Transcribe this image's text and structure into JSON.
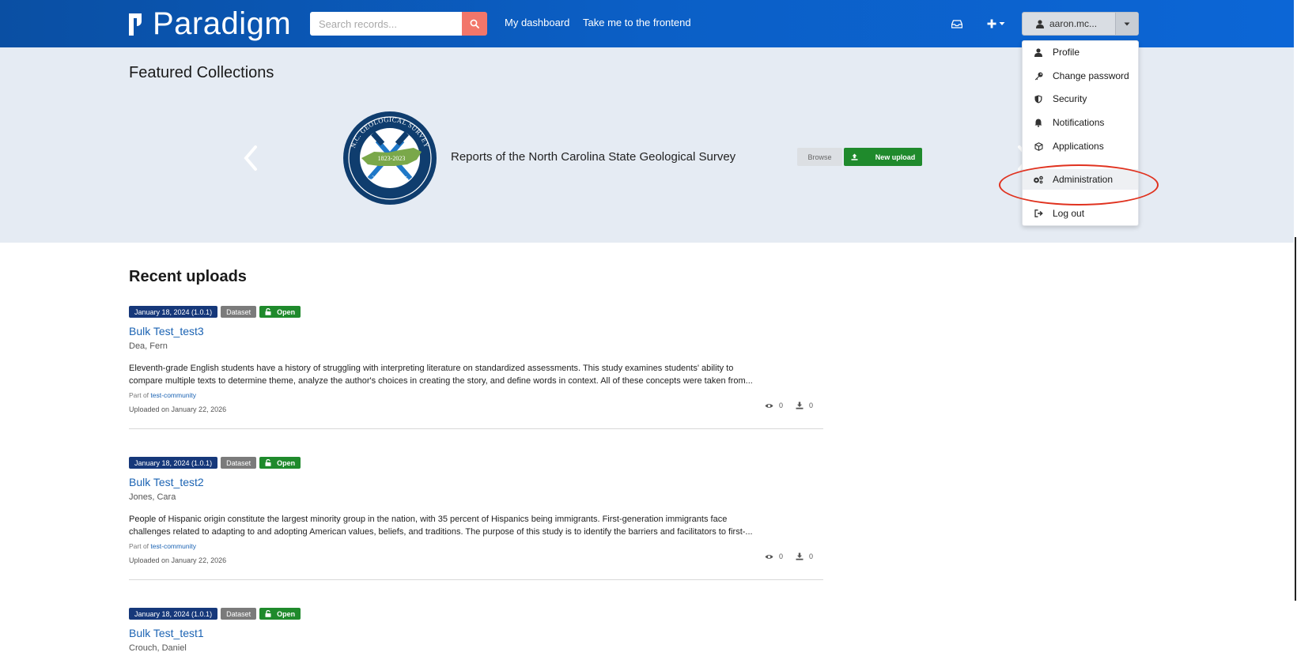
{
  "header": {
    "brand": "Paradigm",
    "search": {
      "placeholder": "Search records..."
    },
    "nav": {
      "dashboard": "My dashboard",
      "frontend": "Take me to the frontend"
    },
    "user": {
      "name": "aaron.mc..."
    }
  },
  "user_menu": {
    "items": [
      {
        "label": "Profile",
        "icon": "user-icon"
      },
      {
        "label": "Change password",
        "icon": "key-icon"
      },
      {
        "label": "Security",
        "icon": "shield-icon"
      },
      {
        "label": "Notifications",
        "icon": "bell-icon"
      },
      {
        "label": "Applications",
        "icon": "cube-icon"
      },
      {
        "label": "Administration",
        "icon": "cogs-icon"
      },
      {
        "label": "Log out",
        "icon": "logout-icon"
      }
    ],
    "highlighted": "Administration"
  },
  "featured": {
    "title": "Featured Collections",
    "collection": {
      "title": "Reports of the North Carolina State Geological Survey",
      "logo_text_top": "N.C. GEOLOGICAL SURVEY",
      "logo_text_bottom": "200 YEARS",
      "logo_years": "1823-2023"
    },
    "browse_label": "Browse",
    "upload_label": "New upload"
  },
  "recent": {
    "title": "Recent uploads",
    "records": [
      {
        "date": "January 18, 2024 (1.0.1)",
        "type": "Dataset",
        "access": "Open",
        "title": "Bulk Test_test3",
        "authors": "Dea, Fern",
        "desc_line1": "Eleventh-grade English students have a history of struggling with interpreting literature on standardized assessments. This study examines students' ability to",
        "desc_line2": "compare multiple texts to determine theme, analyze the author's choices in creating the story, and define words in context. All of these concepts were taken from...",
        "part_of_label": "Part of",
        "community": "test-community",
        "uploaded": "Uploaded on January 22, 2026",
        "views": "0",
        "downloads": "0"
      },
      {
        "date": "January 18, 2024 (1.0.1)",
        "type": "Dataset",
        "access": "Open",
        "title": "Bulk Test_test2",
        "authors": "Jones, Cara",
        "desc_line1": "People of Hispanic origin constitute the largest minority group in the nation, with 35 percent of Hispanics being immigrants. First-generation immigrants face",
        "desc_line2": "challenges related to adapting to and adopting American values, beliefs, and traditions. The purpose of this study is to identify the barriers and facilitators to first-...",
        "part_of_label": "Part of",
        "community": "test-community",
        "uploaded": "Uploaded on January 22, 2026",
        "views": "0",
        "downloads": "0"
      },
      {
        "date": "January 18, 2024 (1.0.1)",
        "type": "Dataset",
        "access": "Open",
        "title": "Bulk Test_test1",
        "authors": "Crouch, Daniel"
      }
    ]
  },
  "colors": {
    "header": "#0b5fc6",
    "band": "#e5ebf3",
    "link": "#1b63b3",
    "green": "#1f8a2c",
    "navy_badge": "#16387a",
    "search_button": "#f2766a",
    "highlight": "#e0321f"
  }
}
